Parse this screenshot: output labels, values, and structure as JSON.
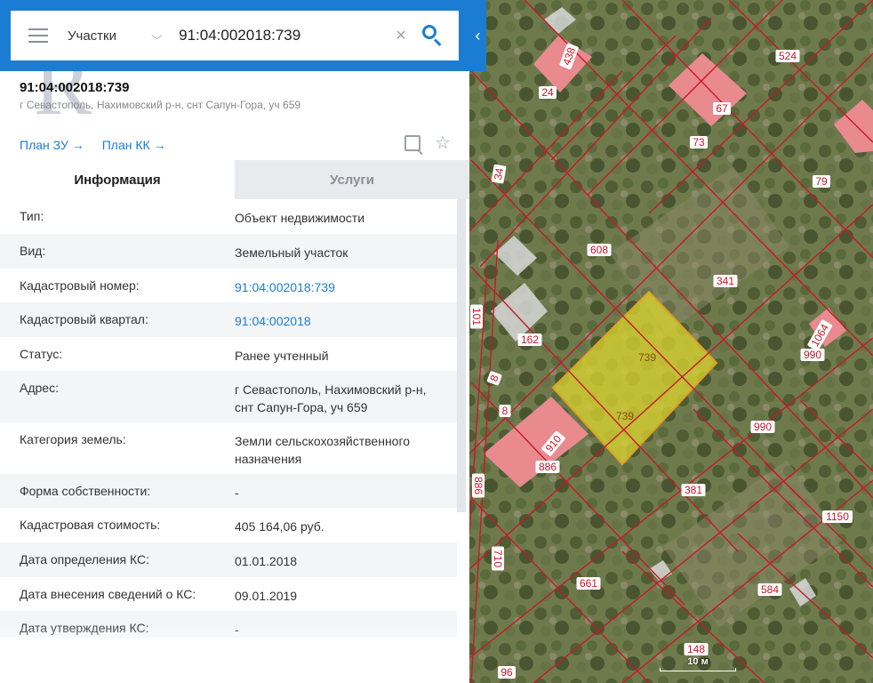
{
  "search": {
    "layer": "Участки",
    "query": "91:04:002018:739"
  },
  "object": {
    "title": "91:04:002018:739",
    "address": "г Севастополь, Нахимовский р-н, снт Сапун-Гора, уч 659",
    "plan_zu": "План ЗУ →",
    "plan_kk": "План КК →"
  },
  "tabs": [
    "Информация",
    "Услуги"
  ],
  "info": [
    {
      "label": "Тип:",
      "value": "Объект недвижимости",
      "link": false
    },
    {
      "label": "Вид:",
      "value": "Земельный участок",
      "link": false
    },
    {
      "label": "Кадастровый номер:",
      "value": "91:04:002018:739",
      "link": true
    },
    {
      "label": "Кадастровый квартал:",
      "value": "91:04:002018",
      "link": true
    },
    {
      "label": "Статус:",
      "value": "Ранее учтенный",
      "link": false
    },
    {
      "label": "Адрес:",
      "value": "г Севастополь, Нахимовский р-н, снт Сапун-Гора, уч 659",
      "link": false
    },
    {
      "label": "Категория земель:",
      "value": "Земли сельскохозяйственного назначения",
      "link": false
    },
    {
      "label": "Форма собственности:",
      "value": "-",
      "link": false
    },
    {
      "label": "Кадастровая стоимость:",
      "value": "405 164,06 руб.",
      "link": false
    },
    {
      "label": "Дата определения КС:",
      "value": "01.01.2018",
      "link": false
    },
    {
      "label": "Дата внесения сведений о КС:",
      "value": "09.01.2019",
      "link": false
    },
    {
      "label": "Дата утверждения КС:",
      "value": "-",
      "link": false
    }
  ],
  "map": {
    "parcel_labels": [
      "739",
      "739",
      "910",
      "886",
      "162",
      "608",
      "341",
      "67",
      "73",
      "79",
      "524",
      "24",
      "438",
      "34",
      "101",
      "8",
      "8",
      "886",
      "710",
      "661",
      "381",
      "990",
      "990",
      "1064",
      "1150",
      "584",
      "148",
      "96"
    ],
    "scale_label": "10 м",
    "colors": {
      "highlight": "#d9d231",
      "building": "#e98a8f",
      "boundary": "#c8182a",
      "label_bg": "#ffffff",
      "label_text": "#c8182a"
    }
  },
  "watermark_text": "RC"
}
